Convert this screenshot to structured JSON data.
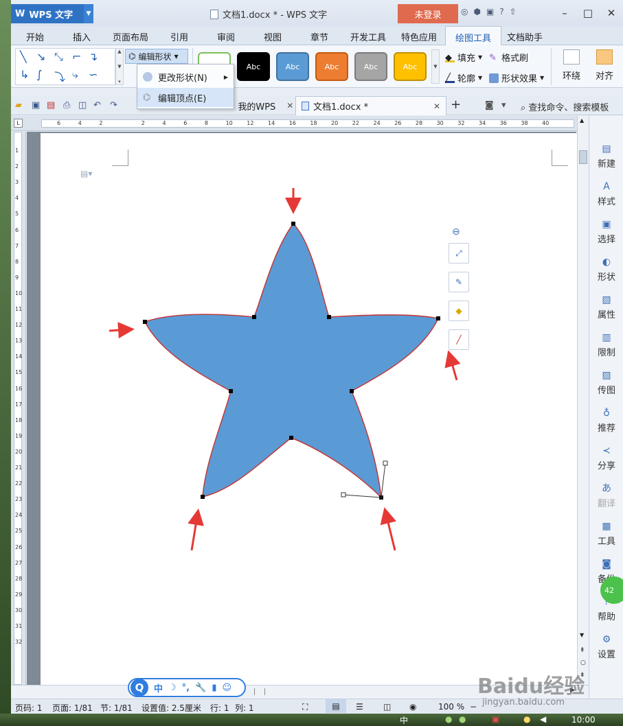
{
  "titlebar": {
    "app_name": "WPS 文字",
    "app_logo": "W",
    "document_title": "文档1.docx * - WPS 文字",
    "login_label": "未登录"
  },
  "menu": {
    "tabs": [
      "开始",
      "插入",
      "页面布局",
      "引用",
      "审阅",
      "视图",
      "章节",
      "开发工具",
      "特色应用",
      "绘图工具",
      "文档助手"
    ],
    "active_tab": "绘图工具"
  },
  "ribbon": {
    "edit_shape_label": "编辑形状",
    "shape_styles": [
      {
        "label": "",
        "color": "#ffffff",
        "border": "#7cbf5a"
      },
      {
        "label": "Abc",
        "color": "#000000",
        "border": "#000000"
      },
      {
        "label": "Abc",
        "color": "#5b9bd5",
        "border": "#41719c"
      },
      {
        "label": "Abc",
        "color": "#ed7d31",
        "border": "#c55a11"
      },
      {
        "label": "Abc",
        "color": "#a5a5a5",
        "border": "#7b7b7b"
      },
      {
        "label": "Abc",
        "color": "#ffc000",
        "border": "#bf9000"
      }
    ],
    "fill_label": "填充",
    "format_painter_label": "格式刷",
    "outline_label": "轮廓",
    "shape_effects_label": "形状效果",
    "wrap_label": "环绕",
    "align_label": "对齐"
  },
  "dropdown": {
    "items": [
      {
        "label": "更改形状(N)",
        "has_submenu": true
      },
      {
        "label": "编辑顶点(E)",
        "has_submenu": false,
        "highlighted": true
      }
    ]
  },
  "doc_tabs": {
    "tabs": [
      {
        "label": "我的WPS",
        "icon": "wps-icon"
      },
      {
        "label": "文档1.docx *",
        "icon": "doc-icon",
        "active": true
      }
    ],
    "new_tab": "+",
    "search_label": "查找命令、搜索模板"
  },
  "ruler": {
    "h_numbers": [
      "6",
      "4",
      "2",
      "",
      "2",
      "4",
      "6",
      "8",
      "10",
      "12",
      "14",
      "16",
      "18",
      "20",
      "22",
      "24",
      "26",
      "28",
      "30",
      "32",
      "34",
      "36",
      "38",
      "40"
    ],
    "v_numbers": [
      "1",
      "2",
      "3",
      "4",
      "5",
      "6",
      "7",
      "8",
      "9",
      "10",
      "11",
      "12",
      "13",
      "14",
      "15",
      "16",
      "17",
      "18",
      "19",
      "20",
      "21",
      "22",
      "23",
      "24",
      "25",
      "26",
      "27",
      "28",
      "29",
      "30",
      "31",
      "32"
    ]
  },
  "shape": {
    "fill": "#5b9bd5",
    "outline": "#c0393b"
  },
  "sidebar": {
    "items": [
      {
        "label": "新建",
        "icon": "new-doc-icon"
      },
      {
        "label": "样式",
        "icon": "style-icon"
      },
      {
        "label": "选择",
        "icon": "select-icon"
      },
      {
        "label": "形状",
        "icon": "shape-icon"
      },
      {
        "label": "属性",
        "icon": "property-icon"
      },
      {
        "label": "限制",
        "icon": "restrict-icon"
      },
      {
        "label": "传图",
        "icon": "upload-image-icon"
      },
      {
        "label": "推荐",
        "icon": "recommend-icon"
      },
      {
        "label": "分享",
        "icon": "share-icon"
      },
      {
        "label": "翻译",
        "icon": "translate-icon",
        "disabled": true
      },
      {
        "label": "工具",
        "icon": "toolbox-icon"
      },
      {
        "label": "备份",
        "icon": "backup-icon"
      },
      {
        "label": "帮助",
        "icon": "help-icon"
      },
      {
        "label": "设置",
        "icon": "settings-icon"
      }
    ],
    "badge": "42"
  },
  "ime": {
    "logo": "Q",
    "mode": "中"
  },
  "status": {
    "page_code": "页码: 1",
    "page": "页面: 1/81",
    "section": "节: 1/81",
    "setting": "设置值: 2.5厘米",
    "row": "行: 1",
    "col": "列: 1",
    "zoom": "100 %"
  },
  "watermark": {
    "brand": "Baidu经验",
    "url": "jingyan.baidu.com"
  },
  "taskbar": {
    "clock": "10:00",
    "ime_label": "中"
  },
  "colors": {
    "accent": "#2f72c4",
    "login": "#e06a4e",
    "arrow": "#e53935"
  }
}
